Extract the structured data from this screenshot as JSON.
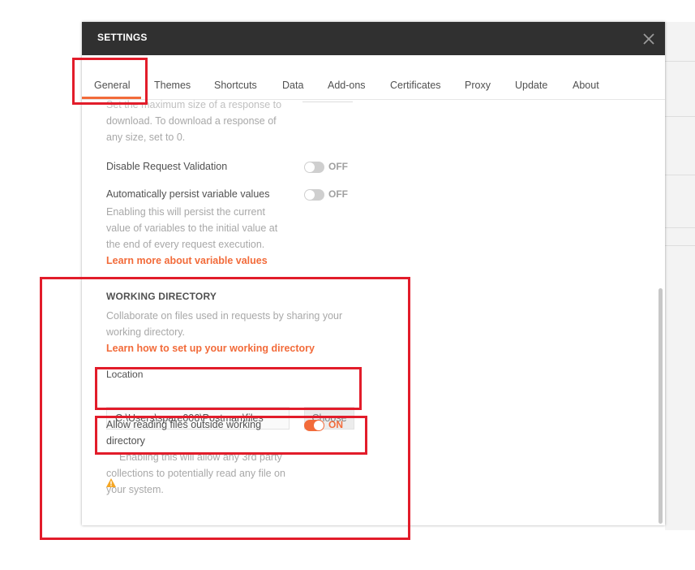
{
  "dialog": {
    "title": "SETTINGS"
  },
  "tabs": [
    {
      "label": "General",
      "active": true
    },
    {
      "label": "Themes"
    },
    {
      "label": "Shortcuts"
    },
    {
      "label": "Data"
    },
    {
      "label": "Add-ons"
    },
    {
      "label": "Certificates"
    },
    {
      "label": "Proxy"
    },
    {
      "label": "Update"
    },
    {
      "label": "About"
    }
  ],
  "response_size": {
    "desc_line1": "Set the maximum size of a response to",
    "desc_line2": "download. To download a response of",
    "desc_line3": "any size, set to 0."
  },
  "request_validation": {
    "label": "Disable Request Validation",
    "state": "OFF"
  },
  "persist_variables": {
    "label": "Automatically persist variable values",
    "state": "OFF",
    "desc_line1": "Enabling this will persist the current",
    "desc_line2": "value of variables to the initial value at",
    "desc_line3": "the end of every request execution.",
    "link": "Learn more about variable values"
  },
  "working_directory": {
    "heading": "WORKING DIRECTORY",
    "desc_line1": "Collaborate on files used in requests by sharing your",
    "desc_line2": "working directory.",
    "link": "Learn how to set up your working directory",
    "location_label": "Location",
    "location_value": "C:\\Users\\spare006\\Postman\\files",
    "choose_label": "Choose"
  },
  "outside_files": {
    "label_line1": "Allow reading files outside working",
    "label_line2": "directory",
    "state": "ON",
    "warning_line1": "Enabling this will allow any 3rd party",
    "warning_line2": "collections to potentially read any file on",
    "warning_line3": "your system."
  },
  "colors": {
    "header_bg": "#303030",
    "accent": "#f26b3a",
    "highlight": "#e21c2a",
    "warning": "#f5a623"
  }
}
